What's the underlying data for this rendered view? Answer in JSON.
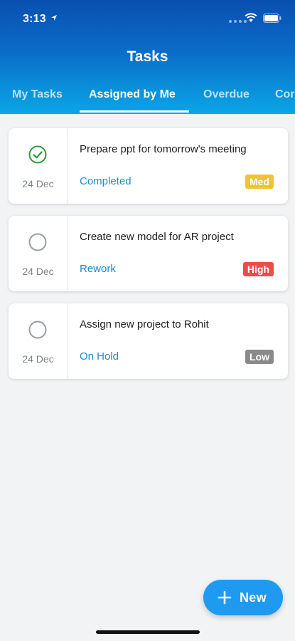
{
  "status_bar": {
    "time": "3:13"
  },
  "header": {
    "title": "Tasks"
  },
  "tabs": [
    {
      "label": "My Tasks",
      "active": false
    },
    {
      "label": "Assigned by Me",
      "active": true
    },
    {
      "label": "Overdue",
      "active": false
    },
    {
      "label": "Cor",
      "active": false
    }
  ],
  "tasks": [
    {
      "title": "Prepare ppt for tomorrow's meeting",
      "date": "24 Dec",
      "status": "Completed",
      "priority": "Med",
      "priority_color": "#f2c230",
      "completed": true,
      "check_icon": "check-circle-icon"
    },
    {
      "title": "Create new model for AR project",
      "date": "24 Dec",
      "status": "Rework",
      "priority": "High",
      "priority_color": "#ee4b4b",
      "completed": false,
      "check_icon": "empty-circle-icon"
    },
    {
      "title": "Assign new project to Rohit",
      "date": "24 Dec",
      "status": "On Hold",
      "priority": "Low",
      "priority_color": "#8a8a8a",
      "completed": false,
      "check_icon": "empty-circle-icon"
    }
  ],
  "fab": {
    "label": "New",
    "icon": "plus-icon"
  },
  "colors": {
    "header_top": "#0a4fb0",
    "header_bottom": "#0aa6e6",
    "status_text": "#1a8bd0",
    "fab": "#1e9af0",
    "check_green": "#2e9a3c"
  }
}
